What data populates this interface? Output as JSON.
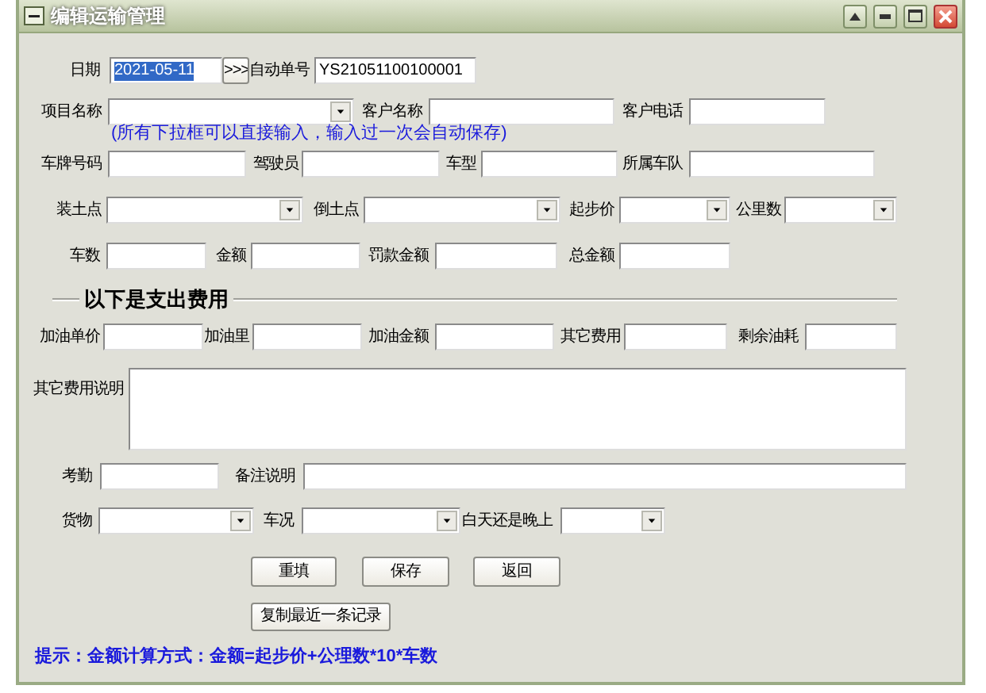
{
  "window": {
    "title": "编辑运输管理"
  },
  "form": [
    {
      "kind": "fields",
      "items": [
        {
          "kind": "label",
          "text": "日期"
        },
        {
          "kind": "input",
          "value": "2021-05-11",
          "text_selected": true
        },
        {
          "kind": "button",
          "text": ">>>"
        },
        {
          "kind": "label",
          "text": "自动单号"
        },
        {
          "kind": "input",
          "value": "YS21051100100001",
          "text_selected": false
        }
      ]
    },
    {
      "kind": "fields",
      "items": [
        {
          "kind": "label",
          "text": "项目名称"
        },
        {
          "kind": "combo"
        },
        {
          "kind": "label",
          "text": "客户名称"
        },
        {
          "kind": "input"
        },
        {
          "kind": "label",
          "text": "客户电话"
        },
        {
          "kind": "input"
        }
      ]
    },
    {
      "kind": "note",
      "text": "(所有下拉框可以直接输入，输入过一次会自动保存)"
    },
    {
      "kind": "fields",
      "items": [
        {
          "kind": "label",
          "text": "车牌号码"
        },
        {
          "kind": "input"
        },
        {
          "kind": "label",
          "text": "驾驶员"
        },
        {
          "kind": "input"
        },
        {
          "kind": "label",
          "text": "车型"
        },
        {
          "kind": "input"
        },
        {
          "kind": "label",
          "text": "所属车队"
        },
        {
          "kind": "input"
        }
      ]
    },
    {
      "kind": "fields",
      "items": [
        {
          "kind": "label",
          "text": "装土点"
        },
        {
          "kind": "combo"
        },
        {
          "kind": "label",
          "text": "倒土点"
        },
        {
          "kind": "combo"
        },
        {
          "kind": "label",
          "text": "起步价"
        },
        {
          "kind": "combo"
        },
        {
          "kind": "label",
          "text": "公里数"
        },
        {
          "kind": "combo"
        }
      ]
    },
    {
      "kind": "fields",
      "items": [
        {
          "kind": "label",
          "text": "车数"
        },
        {
          "kind": "input"
        },
        {
          "kind": "label",
          "text": "金额"
        },
        {
          "kind": "input"
        },
        {
          "kind": "label",
          "text": "罚款金额"
        },
        {
          "kind": "input"
        },
        {
          "kind": "label",
          "text": "总金额"
        },
        {
          "kind": "input"
        }
      ]
    },
    {
      "kind": "section",
      "text": "以下是支出费用"
    },
    {
      "kind": "fields",
      "items": [
        {
          "kind": "label",
          "text": "加油单价"
        },
        {
          "kind": "input"
        },
        {
          "kind": "label",
          "text": "加油里"
        },
        {
          "kind": "input"
        },
        {
          "kind": "label",
          "text": "加油金额"
        },
        {
          "kind": "input"
        },
        {
          "kind": "label",
          "text": "其它费用"
        },
        {
          "kind": "input"
        },
        {
          "kind": "label",
          "text": "剩余油耗"
        },
        {
          "kind": "input"
        }
      ]
    },
    {
      "kind": "fields",
      "items": [
        {
          "kind": "label",
          "text": "其它费用说明"
        },
        {
          "kind": "textarea"
        }
      ]
    },
    {
      "kind": "fields",
      "items": [
        {
          "kind": "label",
          "text": "考勤"
        },
        {
          "kind": "input"
        },
        {
          "kind": "label",
          "text": "备注说明"
        },
        {
          "kind": "input"
        }
      ]
    },
    {
      "kind": "fields",
      "items": [
        {
          "kind": "label",
          "text": "货物"
        },
        {
          "kind": "combo"
        },
        {
          "kind": "label",
          "text": "车况"
        },
        {
          "kind": "combo"
        },
        {
          "kind": "label",
          "text": "白天还是晚上"
        },
        {
          "kind": "combo"
        }
      ]
    },
    {
      "kind": "fields",
      "items": [
        {
          "kind": "button",
          "text": "重填"
        },
        {
          "kind": "button",
          "text": "保存"
        },
        {
          "kind": "button",
          "text": "返回"
        }
      ]
    },
    {
      "kind": "fields",
      "items": [
        {
          "kind": "button",
          "text": "复制最近一条记录"
        }
      ]
    },
    {
      "kind": "hint",
      "text": "提示：金额计算方式：金额=起步价+公理数*10*车数"
    }
  ]
}
